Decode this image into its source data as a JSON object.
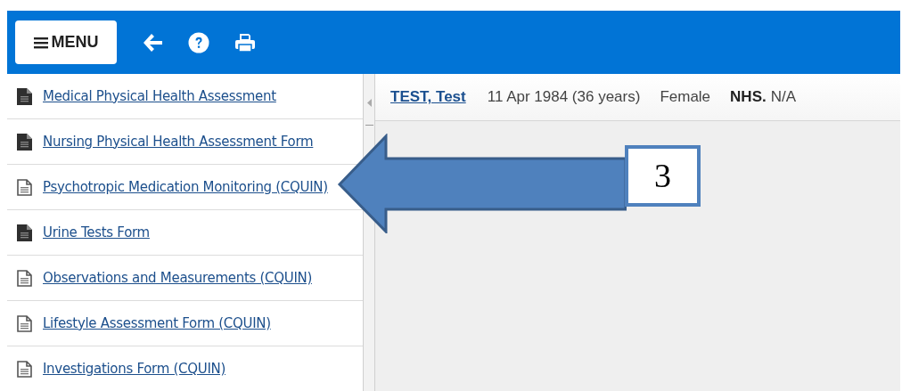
{
  "toolbar": {
    "menu_label": "MENU"
  },
  "sidebar": {
    "items": [
      {
        "label": "Medical Physical Health Assessment",
        "kind": "filled"
      },
      {
        "label": "Nursing Physical Health Assessment Form",
        "kind": "filled"
      },
      {
        "label": "Psychotropic Medication Monitoring (CQUIN)",
        "kind": "outline"
      },
      {
        "label": "Urine Tests Form",
        "kind": "filled"
      },
      {
        "label": "Observations and Measurements (CQUIN)",
        "kind": "outline"
      },
      {
        "label": "Lifestyle Assessment Form (CQUIN)",
        "kind": "outline"
      },
      {
        "label": "Investigations Form (CQUIN)",
        "kind": "outline"
      }
    ]
  },
  "patient": {
    "name": "TEST, Test",
    "dob": "11 Apr 1984 (36 years)",
    "gender": "Female",
    "nhs_label": "NHS.",
    "nhs_value": "N/A"
  },
  "callout": {
    "number": "3"
  }
}
